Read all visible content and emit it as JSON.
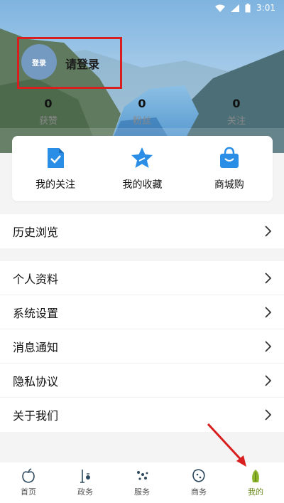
{
  "status_bar": {
    "time": "3:01"
  },
  "profile": {
    "avatar_text": "登录",
    "login_prompt": "请登录"
  },
  "stats": [
    {
      "value": "0",
      "label": "获赞"
    },
    {
      "value": "0",
      "label": "粉丝"
    },
    {
      "value": "0",
      "label": "关注"
    }
  ],
  "quick_actions": [
    {
      "label": "我的关注",
      "icon": "document-check-icon"
    },
    {
      "label": "我的收藏",
      "icon": "star-icon"
    },
    {
      "label": "商城购",
      "icon": "shopping-bag-icon"
    }
  ],
  "history": {
    "label": "历史浏览"
  },
  "menu": [
    {
      "label": "个人资料"
    },
    {
      "label": "系统设置"
    },
    {
      "label": "消息通知"
    },
    {
      "label": "隐私协议"
    },
    {
      "label": "关于我们"
    }
  ],
  "tabs": [
    {
      "label": "首页",
      "icon": "apple-icon"
    },
    {
      "label": "政务",
      "icon": "government-icon"
    },
    {
      "label": "服务",
      "icon": "service-icon"
    },
    {
      "label": "商务",
      "icon": "business-icon"
    },
    {
      "label": "我的",
      "icon": "profile-leaf-icon",
      "active": true
    }
  ],
  "colors": {
    "accent_active": "#6a8a1e",
    "highlight": "#d81e1e",
    "icon_blue": "#2b8ee6"
  }
}
